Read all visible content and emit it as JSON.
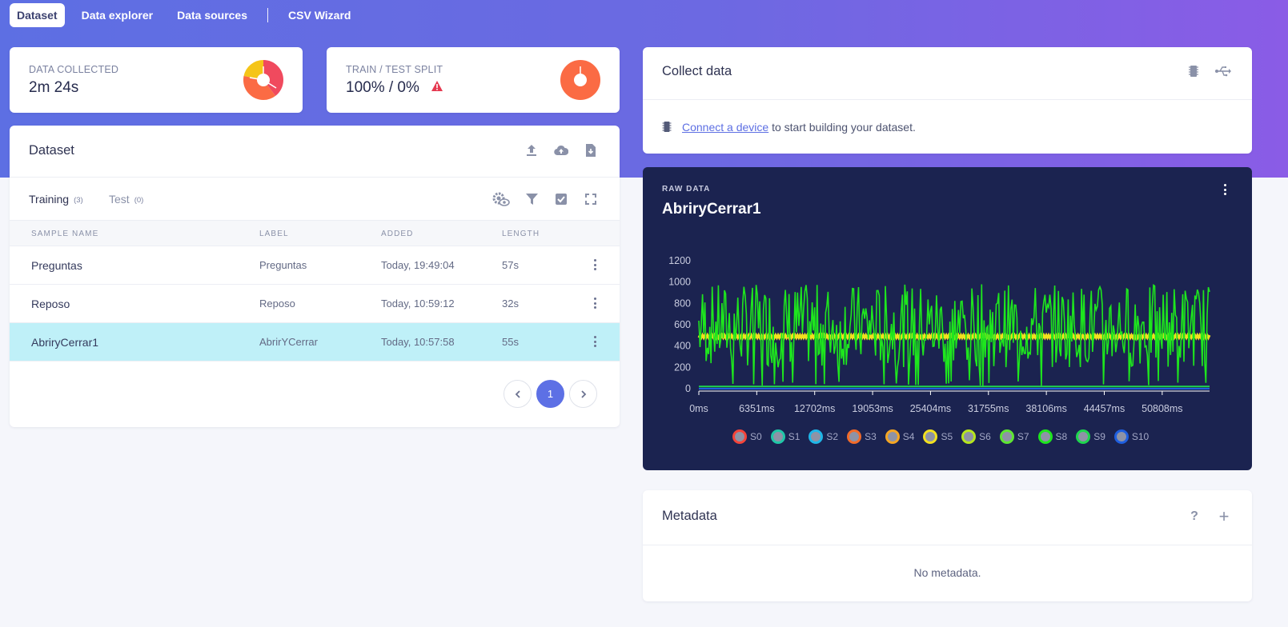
{
  "nav": {
    "tabs": [
      {
        "label": "Dataset",
        "active": true
      },
      {
        "label": "Data explorer",
        "active": false
      },
      {
        "label": "Data sources",
        "active": false
      },
      {
        "label": "CSV Wizard",
        "active": false
      }
    ]
  },
  "kpi_collected": {
    "label": "DATA COLLECTED",
    "value": "2m 24s"
  },
  "kpi_split": {
    "label": "TRAIN / TEST SPLIT",
    "value": "100% / 0%"
  },
  "dataset": {
    "title": "Dataset",
    "tabs": [
      {
        "label": "Training",
        "count": "(3)"
      },
      {
        "label": "Test",
        "count": "(0)"
      }
    ],
    "columns": [
      "SAMPLE NAME",
      "LABEL",
      "ADDED",
      "LENGTH"
    ],
    "rows": [
      {
        "name": "Preguntas",
        "label": "Preguntas",
        "added": "Today, 19:49:04",
        "length": "57s"
      },
      {
        "name": "Reposo",
        "label": "Reposo",
        "added": "Today, 10:59:12",
        "length": "32s"
      },
      {
        "name": "AbriryCerrar1",
        "label": "AbrirYCerrar",
        "added": "Today, 10:57:58",
        "length": "55s"
      }
    ],
    "page": "1"
  },
  "collect": {
    "title": "Collect data",
    "link_text": "Connect a device",
    "rest_text": " to start building your dataset."
  },
  "raw": {
    "label": "RAW DATA",
    "title": "AbriryCerrar1"
  },
  "metadata": {
    "title": "Metadata",
    "empty": "No metadata."
  },
  "colors": {
    "accent": "#5d70e5",
    "selected_row": "#bff0f8",
    "chart_bg": "#1b2350"
  },
  "chart_data": {
    "type": "line",
    "y_ticks": [
      "1200",
      "1000",
      "800",
      "600",
      "400",
      "200",
      "0"
    ],
    "x_ticks": [
      "0ms",
      "6351ms",
      "12702ms",
      "19053ms",
      "25404ms",
      "31755ms",
      "38106ms",
      "44457ms",
      "50808ms"
    ],
    "ylim": [
      0,
      1200
    ],
    "xlim": [
      0,
      56000
    ],
    "series": [
      {
        "name": "S0",
        "color": "#f5443a",
        "level": 0
      },
      {
        "name": "S1",
        "color": "#21c7a8",
        "level": 0
      },
      {
        "name": "S2",
        "color": "#1fb6e8",
        "level": 0
      },
      {
        "name": "S3",
        "color": "#f26b2a",
        "level": 0
      },
      {
        "name": "S4",
        "color": "#f5a623",
        "level": 0
      },
      {
        "name": "S5",
        "color": "#f2e01e",
        "level": 500
      },
      {
        "name": "S6",
        "color": "#b7e61e",
        "level": 0
      },
      {
        "name": "S7",
        "color": "#5ee632",
        "level": 0
      },
      {
        "name": "S8",
        "color": "#1ee61e",
        "level": 600
      },
      {
        "name": "S9",
        "color": "#1ed64e",
        "level": 20
      },
      {
        "name": "S10",
        "color": "#1f5fe0",
        "level": 0
      }
    ]
  }
}
